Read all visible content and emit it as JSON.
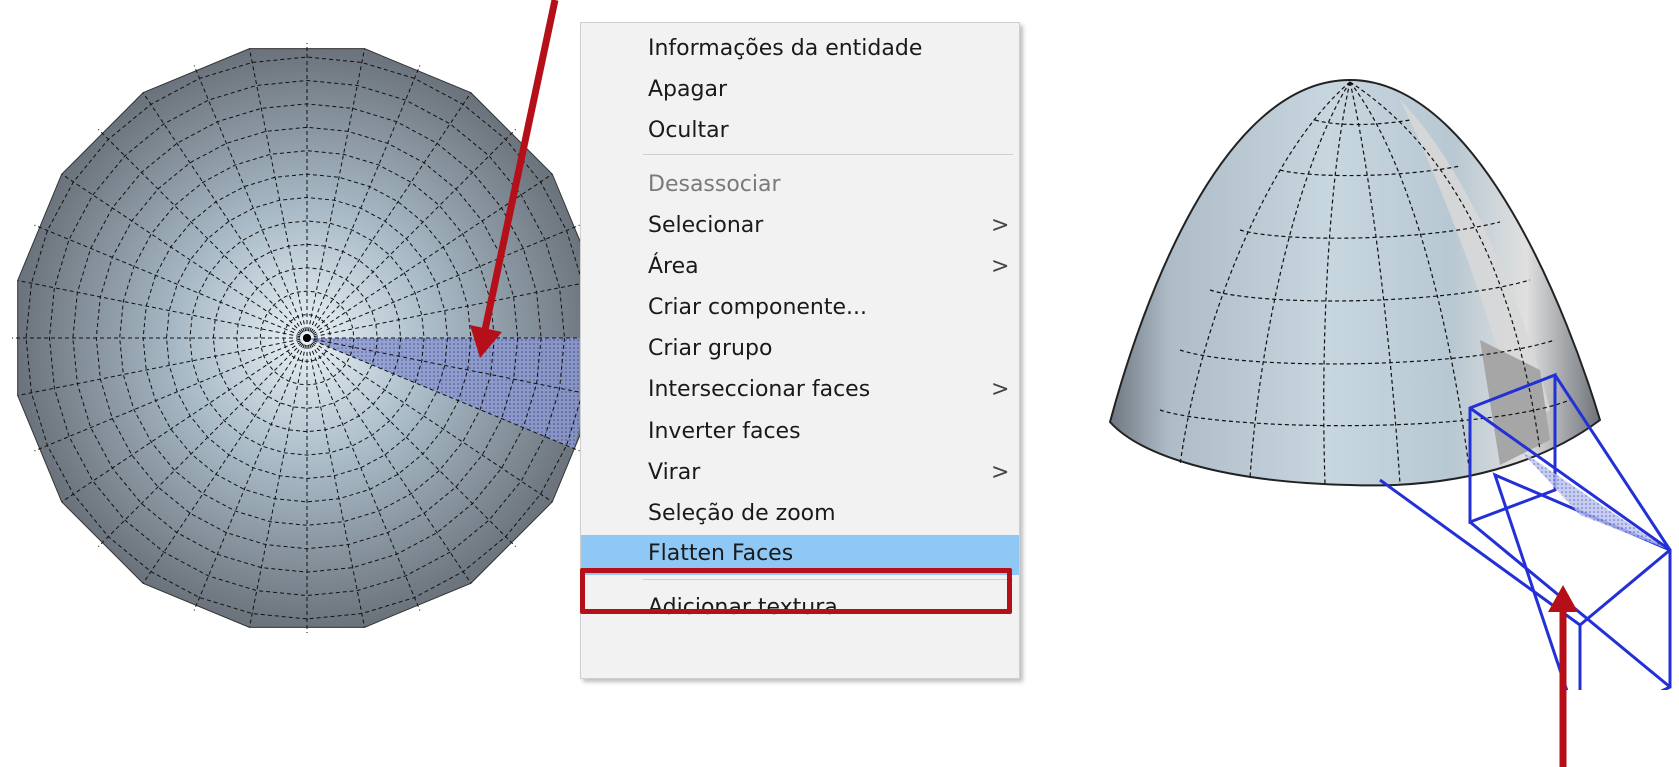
{
  "context_menu": {
    "items": [
      {
        "label": "Informações da entidade",
        "submenu": false,
        "disabled": false
      },
      {
        "label": "Apagar",
        "submenu": false,
        "disabled": false
      },
      {
        "label": "Ocultar",
        "submenu": false,
        "disabled": false
      },
      {
        "label": "Desassociar",
        "submenu": false,
        "disabled": true
      },
      {
        "label": "Selecionar",
        "submenu": true,
        "disabled": false
      },
      {
        "label": "Área",
        "submenu": true,
        "disabled": false
      },
      {
        "label": "Criar componente...",
        "submenu": false,
        "disabled": false
      },
      {
        "label": "Criar grupo",
        "submenu": false,
        "disabled": false
      },
      {
        "label": "Interseccionar faces",
        "submenu": true,
        "disabled": false
      },
      {
        "label": "Inverter faces",
        "submenu": false,
        "disabled": false
      },
      {
        "label": "Virar",
        "submenu": true,
        "disabled": false
      },
      {
        "label": "Seleção de zoom",
        "submenu": false,
        "disabled": false
      },
      {
        "label": "Flatten Faces",
        "submenu": false,
        "disabled": false,
        "highlighted": true
      },
      {
        "label": "Adicionar textura...",
        "submenu": false,
        "disabled": false
      }
    ],
    "chevron": ">",
    "highlight_color": "#90c8f5",
    "callout_color": "#b5101a"
  },
  "icons": {
    "top_view": "dome-top-view-icon",
    "perspective_view": "dome-perspective-icon",
    "arrows": "red-arrow-icon"
  }
}
